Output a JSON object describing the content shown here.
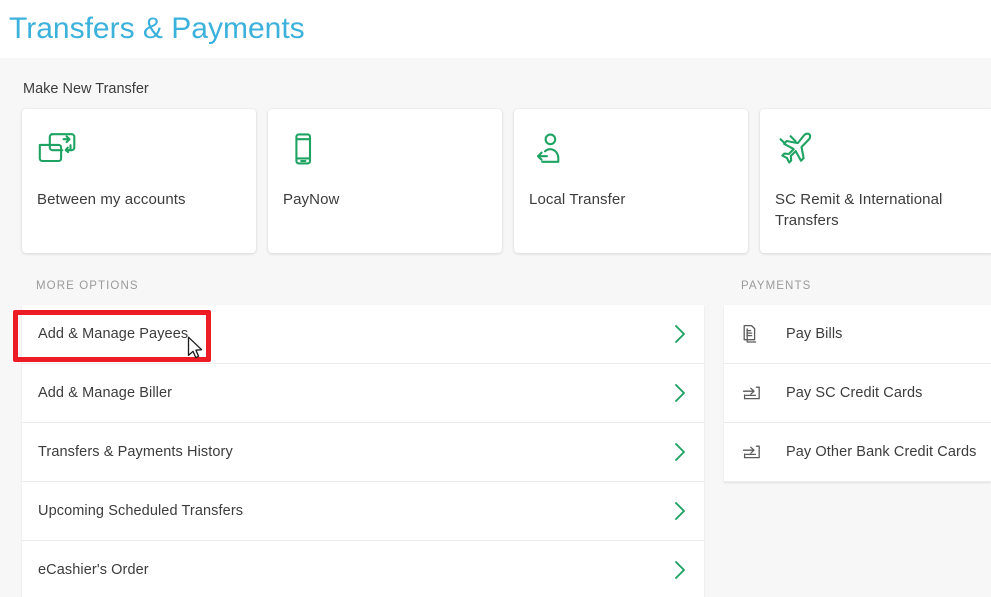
{
  "page": {
    "title": "Transfers & Payments",
    "title_color": "#3bb1dc",
    "background": "#f7f7f7",
    "accent_green": "#1ea362",
    "highlight_color": "#ed1c24"
  },
  "make_new_transfer": {
    "section_label": "Make New Transfer",
    "cards": [
      {
        "label": "Between my accounts",
        "icon": "transfer-between-accounts-icon"
      },
      {
        "label": "PayNow",
        "icon": "mobile-phone-icon"
      },
      {
        "label": "Local Transfer",
        "icon": "person-transfer-icon"
      },
      {
        "label": "SC Remit & International Transfers",
        "icon": "airplane-icon"
      }
    ]
  },
  "more_options": {
    "header": "MORE OPTIONS",
    "items": [
      {
        "label": "Add & Manage Payees",
        "chevron": "chevron-right-icon",
        "highlighted": true
      },
      {
        "label": "Add & Manage Biller",
        "chevron": "chevron-right-icon",
        "highlighted": false
      },
      {
        "label": "Transfers & Payments History",
        "chevron": "chevron-right-icon",
        "highlighted": false
      },
      {
        "label": "Upcoming Scheduled Transfers",
        "chevron": "chevron-right-icon",
        "highlighted": false
      },
      {
        "label": "eCashier's Order",
        "chevron": "chevron-right-icon",
        "highlighted": false
      }
    ]
  },
  "payments": {
    "header": "PAYMENTS",
    "items": [
      {
        "label": "Pay Bills",
        "icon": "bill-document-icon"
      },
      {
        "label": "Pay SC Credit Cards",
        "icon": "credit-card-arrow-icon"
      },
      {
        "label": "Pay Other Bank Credit Cards",
        "icon": "credit-card-arrow-icon"
      }
    ]
  }
}
